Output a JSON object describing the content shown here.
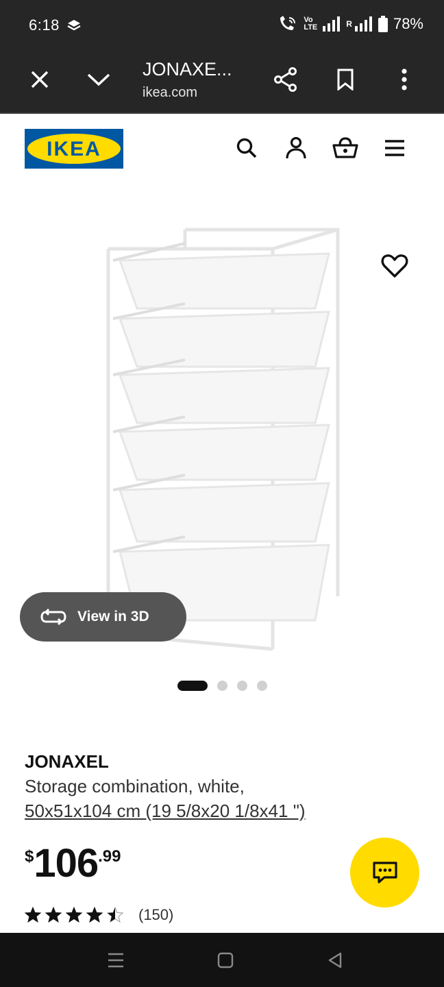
{
  "status": {
    "time": "6:18",
    "network_vo": "Vo",
    "network_lte": "LTE",
    "roaming": "R",
    "battery": "78%"
  },
  "browser": {
    "title": "JONAXE...",
    "url": "ikea.com"
  },
  "logo": {
    "text": "IKEA",
    "colors": {
      "blue": "#0058a3",
      "yellow": "#ffdb00"
    }
  },
  "product": {
    "name": "JONAXEL",
    "description": "Storage combination, white,",
    "dimensions": "50x51x104 cm (19 5/8x20 1/8x41 \")",
    "price_currency": "$",
    "price_integer": "106",
    "price_decimal": ".99",
    "rating": 4.5,
    "rating_count": "(150)",
    "image_dots": 4,
    "active_dot": 0
  },
  "view3d": {
    "label": "View in 3D"
  },
  "colors": {
    "dark_bar": "#262626",
    "chat_yellow": "#ffdb00",
    "view3d_bg": "#555555"
  }
}
